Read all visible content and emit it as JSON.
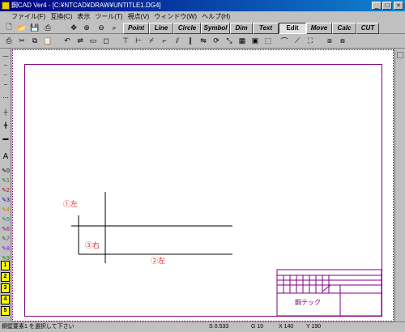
{
  "window": {
    "title": "鋼CAD Ver4 - [C:¥NTCAD¥DRAW¥UNTITLE1.DG4]",
    "minimize": "_",
    "maximize": "□",
    "close": "×"
  },
  "menu": [
    "ファイル(F)",
    "互換(C)",
    "表示",
    "ツール(T)",
    "視点(V)",
    "ウィンドウ(W)",
    "ヘルプ(H)"
  ],
  "tabs": [
    "Point",
    "Line",
    "Circle",
    "Symbol",
    "Dim",
    "Text",
    "Edit",
    "Move",
    "Calc",
    "CUT"
  ],
  "active_tab": "Edit",
  "left_numbers": [
    "0",
    "1",
    "2",
    "3",
    "4",
    "5",
    "6",
    "7",
    "8",
    "9"
  ],
  "layer_numbers": [
    "1",
    "2",
    "3",
    "4",
    "5"
  ],
  "drawing": {
    "label1": "①左",
    "label2": "②左",
    "label3": "③右"
  },
  "title_block": {
    "company": "鋼テック"
  },
  "status": {
    "message": "鋼壁要素1 を選択して下さい",
    "scale": "S 0.533",
    "grid": "G 10",
    "x": "X 140",
    "y": "Y 190"
  },
  "colors": {
    "title_bar": "#000080",
    "frame": "#800080",
    "annotation": "#e03030",
    "layer_highlight": "#ffff00"
  }
}
